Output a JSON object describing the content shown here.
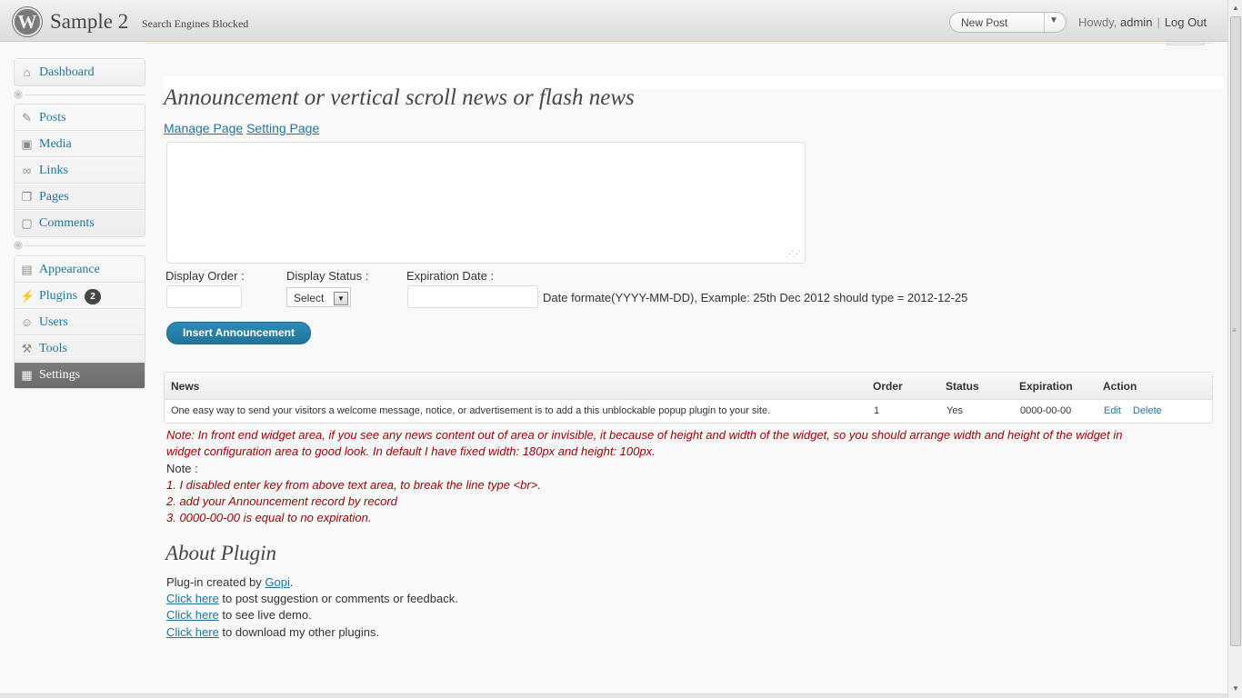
{
  "header": {
    "logo_glyph": "W",
    "site_title": "Sample 2",
    "site_description": "Search Engines Blocked",
    "new_post_label": "New Post",
    "howdy": "Howdy,",
    "username": "admin",
    "separator": "|",
    "logout": "Log Out"
  },
  "sidebar": {
    "groups": [
      [
        {
          "label": "Dashboard",
          "icon": "dashboard-icon"
        }
      ],
      [
        {
          "label": "Posts",
          "icon": "pin-icon"
        },
        {
          "label": "Media",
          "icon": "media-icon"
        },
        {
          "label": "Links",
          "icon": "link-icon"
        },
        {
          "label": "Pages",
          "icon": "pages-icon"
        },
        {
          "label": "Comments",
          "icon": "comment-icon"
        }
      ],
      [
        {
          "label": "Appearance",
          "icon": "appearance-icon"
        },
        {
          "label": "Plugins",
          "icon": "plugin-icon",
          "badge": "2"
        },
        {
          "label": "Users",
          "icon": "users-icon"
        },
        {
          "label": "Tools",
          "icon": "tools-icon"
        },
        {
          "label": "Settings",
          "icon": "settings-icon",
          "current": true
        }
      ]
    ]
  },
  "main": {
    "title": "Announcement or vertical scroll news or flash news",
    "tabs": [
      "Manage Page",
      "Setting Page"
    ],
    "announcement_text": "",
    "form": {
      "display_order_label": "Display Order :",
      "display_order_value": "",
      "display_status_label": "Display Status :",
      "display_status_value": "Select",
      "expiration_label": "Expiration Date :",
      "expiration_value": "",
      "date_hint": "Date formate(YYYY-MM-DD), Example: 25th Dec 2012 should type = 2012-12-25",
      "insert_button": "Insert Announcement"
    },
    "table": {
      "headers": [
        "News",
        "Order",
        "Status",
        "Expiration",
        "Action"
      ],
      "rows": [
        {
          "news": "One easy way to send your visitors a welcome message, notice, or advertisement is to add a this unblockable popup plugin to your site.",
          "order": "1",
          "status": "Yes",
          "expiration": "0000-00-00",
          "edit": "Edit",
          "delete": "Delete"
        }
      ]
    },
    "notes": {
      "note1_line1": "Note: In front end widget area, if you see any news content out of area or invisible, it because of height and width of the widget, so you should arrange width and height of the widget in",
      "note1_line2": "widget configuration area to good look. In default I have fixed width: 180px and height: 100px.",
      "note_heading": "Note :",
      "items": [
        "1. I disabled enter key from above text area, to break the line type <br>.",
        "2. add your Announcement record by record",
        "3. 0000-00-00 is equal to no expiration."
      ]
    },
    "about": {
      "title": "About Plugin",
      "created_prefix": "Plug-in created by ",
      "author": "Gopi",
      "created_suffix": ".",
      "links": [
        {
          "link": "Click here",
          "text": " to post suggestion or comments or feedback."
        },
        {
          "link": "Click here",
          "text": " to see live demo."
        },
        {
          "link": "Click here",
          "text": " to download my other plugins."
        }
      ]
    }
  },
  "colors": {
    "link": "#21759b",
    "note": "#990000",
    "button": "#21759b"
  }
}
